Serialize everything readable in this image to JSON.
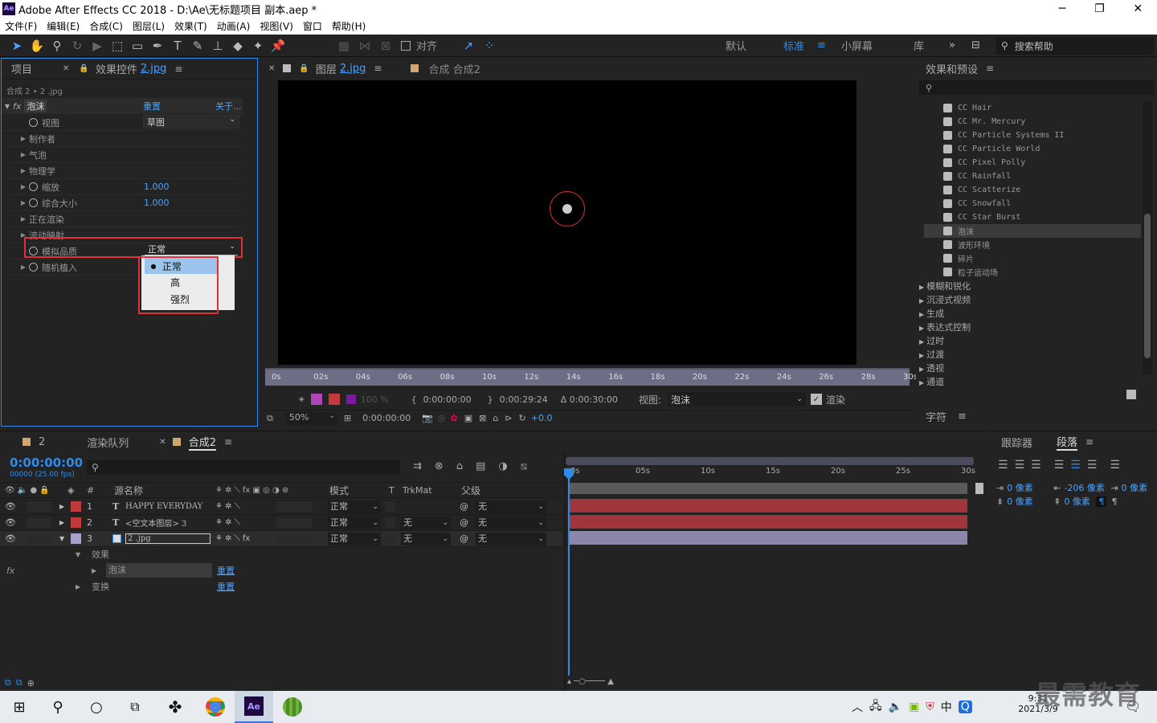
{
  "window": {
    "title": "Adobe After Effects CC 2018 - D:\\Ae\\无标题项目 副本.aep *",
    "app_icon": "Ae",
    "controls": [
      "minimize-icon",
      "restore-icon",
      "close-icon"
    ]
  },
  "menu": [
    "文件(F)",
    "编辑(E)",
    "合成(C)",
    "图层(L)",
    "效果(T)",
    "动画(A)",
    "视图(V)",
    "窗口",
    "帮助(H)"
  ],
  "toolbar": {
    "snap_label": "对齐",
    "workspaces": [
      "默认",
      "标准",
      "小屏幕",
      "库"
    ],
    "active_workspace": "标准",
    "search_placeholder": "搜索帮助"
  },
  "left_panel": {
    "tab_project": "项目",
    "tab_effect_controls": "效果控件",
    "tab_effect_controls_target": "2.jpg",
    "breadcrumb": "合成 2 • 2 .jpg",
    "effect": {
      "name": "泡沫",
      "reset": "重置",
      "about": "关于..."
    },
    "props": [
      {
        "label": "视图",
        "value": "草图",
        "stopwatch": true,
        "expand": false
      },
      {
        "label": "制作者",
        "expand": true
      },
      {
        "label": "气泡",
        "expand": true
      },
      {
        "label": "物理学",
        "expand": true
      },
      {
        "label": "缩放",
        "value": "1.000",
        "stopwatch": true,
        "expand": true
      },
      {
        "label": "综合大小",
        "value": "1.000",
        "stopwatch": true,
        "expand": true
      },
      {
        "label": "正在渲染",
        "expand": true
      },
      {
        "label": "流动映射",
        "expand": true
      },
      {
        "label": "模拟品质",
        "value": "正常",
        "stopwatch": true,
        "expand": false
      },
      {
        "label": "随机植入",
        "stopwatch": true,
        "expand": true
      }
    ],
    "dropdown_options": [
      "正常",
      "高",
      "强烈"
    ],
    "dropdown_selected": "正常"
  },
  "viewer": {
    "tab_layer": "图层",
    "tab_layer_target": "2.jpg",
    "tab_comp": "合成 合成2",
    "ruler_ticks": [
      "0s",
      "02s",
      "04s",
      "06s",
      "08s",
      "10s",
      "12s",
      "14s",
      "16s",
      "18s",
      "20s",
      "22s",
      "24s",
      "26s",
      "28s",
      "30s"
    ],
    "opacity": "100 %",
    "in_time": "0:00:00:00",
    "out_time": "0:00:29:24",
    "duration": "Δ 0:00:30:00",
    "view_label": "视图:",
    "view_value": "泡沫",
    "render_label": "渲染",
    "zoom": "50%",
    "current_time": "0:00:00:00",
    "exposure": "+0.0"
  },
  "effects_presets": {
    "title": "效果和预设",
    "search_placeholder": "",
    "items": [
      "CC Hair",
      "CC Mr. Mercury",
      "CC Particle Systems II",
      "CC Particle World",
      "CC Pixel Polly",
      "CC Rainfall",
      "CC Scatterize",
      "CC Snowfall",
      "CC Star Burst",
      "泡沫",
      "波形环境",
      "碎片",
      "粒子运动场"
    ],
    "selected": "泡沫",
    "categories": [
      "模糊和锐化",
      "沉浸式视频",
      "生成",
      "表达式控制",
      "过时",
      "过渡",
      "透视",
      "通道"
    ],
    "char_panel": "字符"
  },
  "timeline": {
    "tabs": [
      "2",
      "渲染队列",
      "合成2"
    ],
    "active_tab": "合成2",
    "timecode": "0:00:00:00",
    "fps": "00000 (25.00 fps)",
    "headers": {
      "num": "#",
      "name": "源名称",
      "mode": "模式",
      "t": "T",
      "trkmat": "TrkMat",
      "parent": "父级"
    },
    "layers": [
      {
        "num": "1",
        "type": "T",
        "name": "HAPPY EVERYDAY",
        "mode": "正常",
        "trkmat": "",
        "parent": "无",
        "color": "#c0393b"
      },
      {
        "num": "2",
        "type": "T",
        "name": "<空文本图层> 3",
        "mode": "正常",
        "trkmat": "无",
        "parent": "无",
        "color": "#c0393b"
      },
      {
        "num": "3",
        "type": "",
        "name": "2 .jpg",
        "mode": "正常",
        "trkmat": "无",
        "parent": "无",
        "color": "#a9a2c8"
      }
    ],
    "sub_effects": "效果",
    "sub_effect_name": "泡沫",
    "sub_reset": "重置",
    "sub_transform": "变换",
    "sub_transform_reset": "重置",
    "ruler": [
      "0s",
      "05s",
      "10s",
      "15s",
      "20s",
      "25s",
      "30s"
    ]
  },
  "right_bottom": {
    "tab_tracker": "跟踪器",
    "tab_paragraph": "段落",
    "indent_values": [
      "0 像素",
      "-206 像素",
      "0 像素",
      "0 像素",
      "0 像素"
    ]
  },
  "taskbar": {
    "time": "9:31",
    "date": "2021/3/9",
    "ime": "中",
    "watermark": "最需教育"
  }
}
